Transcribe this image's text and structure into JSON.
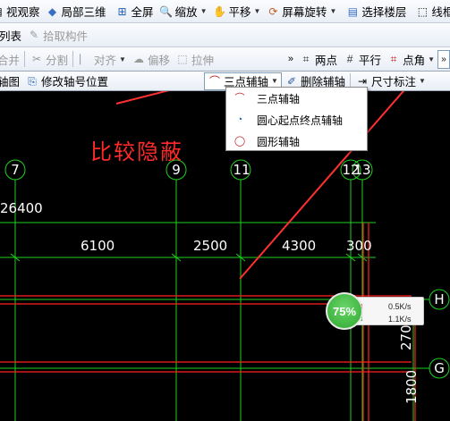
{
  "toolbar1": {
    "items": [
      "视观察",
      "局部三维",
      "全屏",
      "缩放",
      "平移",
      "屏幕旋转",
      "选择楼层",
      "线框"
    ]
  },
  "toolbar2": {
    "items": [
      "列表",
      "拾取构件"
    ]
  },
  "toolbar3": {
    "left": [
      "合并",
      "分割",
      "对齐",
      "偏移",
      "拉伸"
    ],
    "right": [
      "两点",
      "平行",
      "点角"
    ]
  },
  "toolbar4": {
    "left": [
      "轴图",
      "修改轴号位置"
    ],
    "three_point": "三点辅轴",
    "delete": "删除辅轴",
    "dimension": "尺寸标注"
  },
  "popup": {
    "items": [
      "三点辅轴",
      "圆心起点终点辅轴",
      "圆形辅轴"
    ]
  },
  "annotation": "比较隐蔽",
  "canvas": {
    "axis_numbers_top": [
      "7",
      "9",
      "11",
      "12",
      "13"
    ],
    "axis_letters_right": [
      "H",
      "G"
    ],
    "dimensions": [
      "26400",
      "6100",
      "2500",
      "4300",
      "300",
      "270",
      "1800"
    ]
  },
  "speed_widget": {
    "percent": "75%",
    "up": "0.5K/s",
    "down": "1.1K/s"
  },
  "colors": {
    "grid_green": "#1fd11f",
    "grid_red": "#ff2020",
    "arrow_red": "#ff3030",
    "canvas_bg": "#000000"
  }
}
